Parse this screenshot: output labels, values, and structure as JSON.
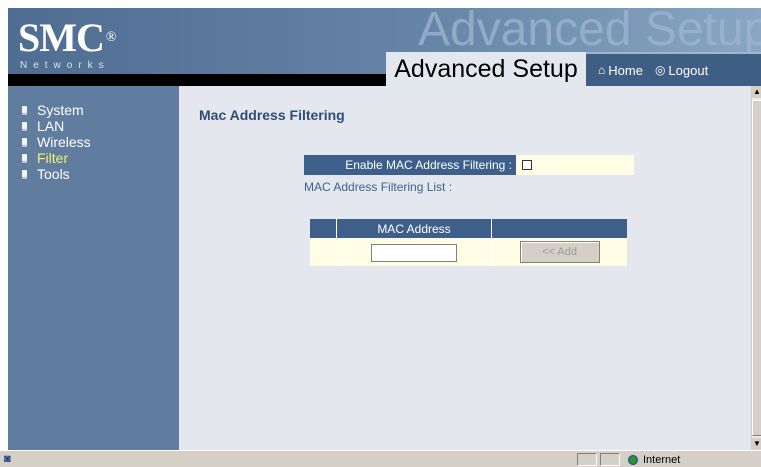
{
  "header": {
    "logo": "SMC",
    "logo_registered": "®",
    "logo_sub": "Networks",
    "watermark": "Advanced Setup",
    "title": "Advanced Setup",
    "nav": [
      {
        "label": "Home",
        "icon": "home-icon"
      },
      {
        "label": "Logout",
        "icon": "logout-icon"
      }
    ]
  },
  "sidebar": {
    "items": [
      {
        "label": "System",
        "active": false
      },
      {
        "label": "LAN",
        "active": false
      },
      {
        "label": "Wireless",
        "active": false
      },
      {
        "label": "Filter",
        "active": true
      },
      {
        "label": "Tools",
        "active": false
      }
    ]
  },
  "main": {
    "title": "Mac Address Filtering",
    "enable_label": "Enable MAC Address Filtering :",
    "enable_checked": false,
    "list_label": "MAC Address Filtering List :",
    "table": {
      "columns": [
        "",
        "MAC Address",
        ""
      ],
      "mac_value": "",
      "add_button": "<< Add"
    }
  },
  "statusbar": {
    "zone": "Internet"
  },
  "colors": {
    "header_bg": "#5a7a9e",
    "sidebar_bg": "#607c9e",
    "content_bg": "#e4e8ee",
    "label_bg": "#3e5f8a",
    "cell_bg": "#fffde6",
    "active_nav": "#f3f36b"
  }
}
